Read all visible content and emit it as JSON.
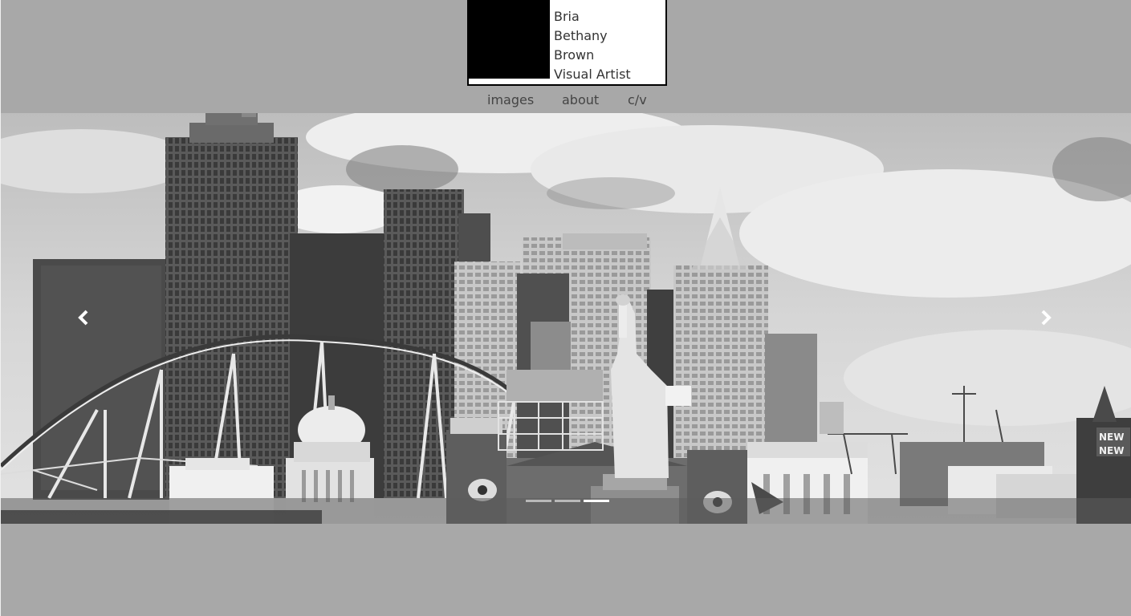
{
  "header": {
    "name_lines": [
      "Bria",
      "Bethany",
      "Brown",
      "Visual Artist"
    ]
  },
  "nav": {
    "items": [
      {
        "label": "images"
      },
      {
        "label": "about"
      },
      {
        "label": "c/v"
      }
    ]
  },
  "carousel": {
    "image": "Black and white photo of the New York-New York hotel skyline with Statue of Liberty replica and roller coaster",
    "signage_text": [
      "NEW",
      "NEW"
    ],
    "prev_icon": "chevron-left-icon",
    "next_icon": "chevron-right-icon",
    "active_slide": 3,
    "slide_count": 3
  },
  "colors": {
    "page_bg": "#a8a8a8",
    "card_bg": "#ffffff",
    "logo_block": "#000000",
    "nav_text": "#444444"
  }
}
